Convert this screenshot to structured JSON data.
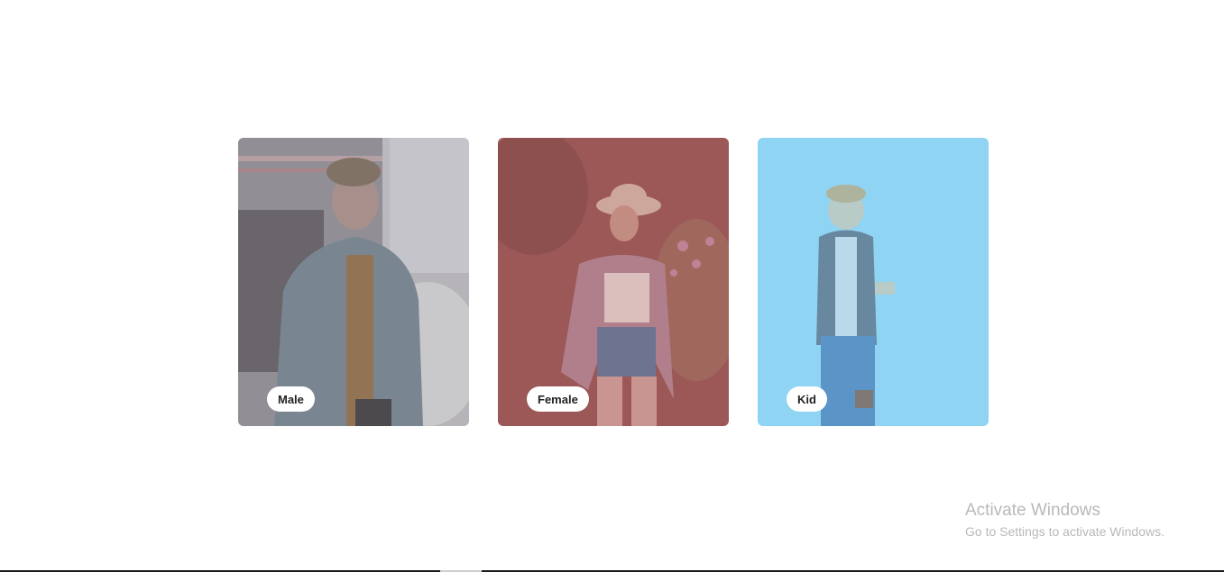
{
  "categories": [
    {
      "id": "male",
      "label": "Male",
      "tint": "#a7a7ad"
    },
    {
      "id": "female",
      "label": "Female",
      "tint": "#9e5a58"
    },
    {
      "id": "kid",
      "label": "Kid",
      "tint": "#8fd4f2"
    }
  ],
  "watermark": {
    "title": "Activate Windows",
    "subtitle": "Go to Settings to activate Windows."
  }
}
